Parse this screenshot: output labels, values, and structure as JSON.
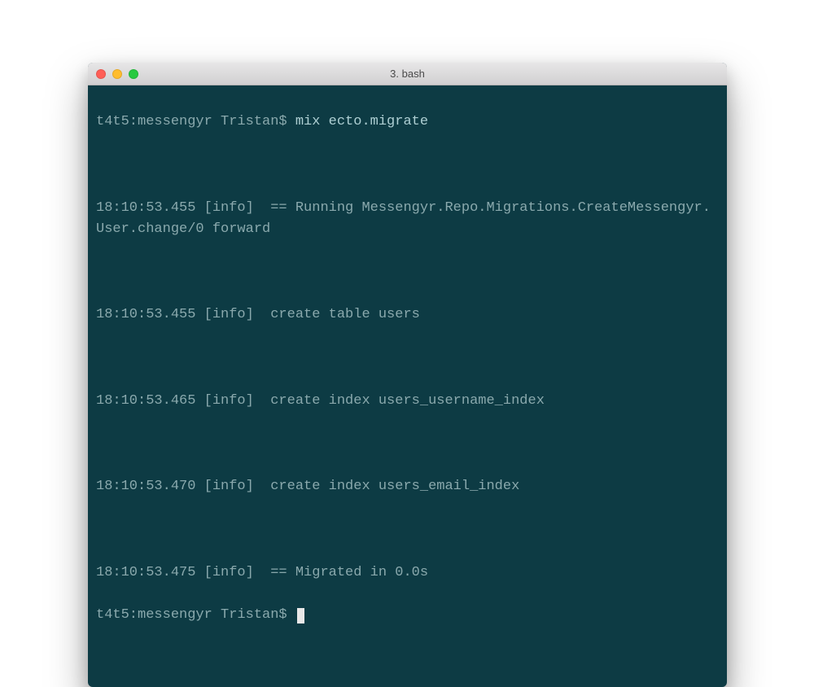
{
  "titlebar": {
    "title": "3. bash"
  },
  "terminal": {
    "prompt1": "t4t5:messengyr Tristan$ ",
    "command": "mix ecto.migrate",
    "lines": {
      "l1": "18:10:53.455 [info]  == Running Messengyr.Repo.Migrations.CreateMessengyr.User.change/0 forward",
      "l2": "18:10:53.455 [info]  create table users",
      "l3": "18:10:53.465 [info]  create index users_username_index",
      "l4": "18:10:53.470 [info]  create index users_email_index",
      "l5": "18:10:53.475 [info]  == Migrated in 0.0s"
    },
    "prompt2": "t4t5:messengyr Tristan$ "
  },
  "colors": {
    "terminal_bg": "#0d3b44",
    "text_dim": "#8aa9ad",
    "text_bright": "#aecfd3",
    "cursor": "#e8e8e8"
  }
}
